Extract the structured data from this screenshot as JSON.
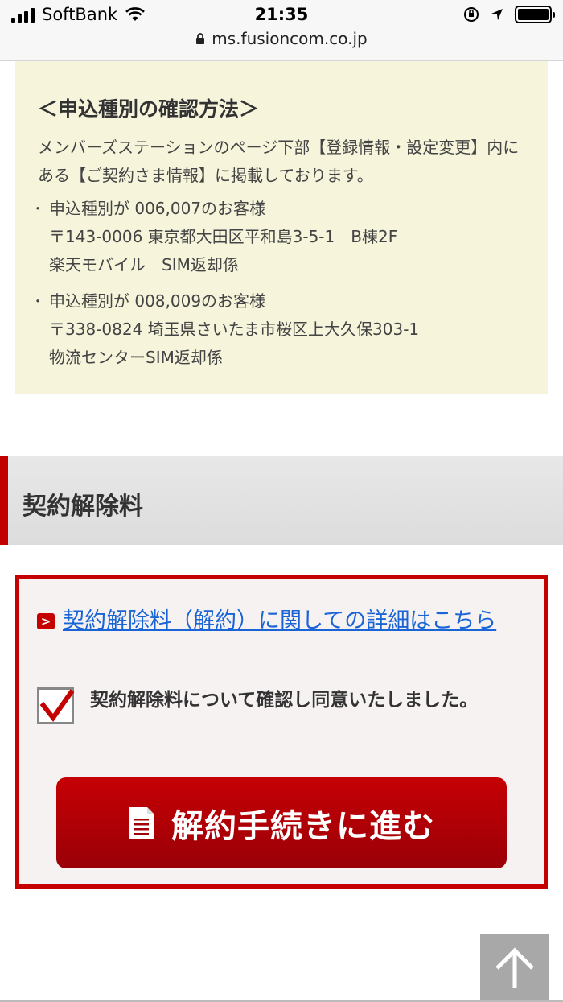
{
  "status_bar": {
    "carrier": "SoftBank",
    "time": "21:35",
    "url": "ms.fusioncom.co.jp",
    "battery_level": 1.0
  },
  "info_box": {
    "title": "＜申込種別の確認方法＞",
    "description": "メンバーズステーションのページ下部【登録情報・設定変更】内にある【ご契約さま情報】に掲載しております。",
    "items": [
      {
        "line1": "申込種別が 006,007のお客様",
        "line2": "〒143-0006 東京都大田区平和島3-5-1　B棟2F",
        "line3": "楽天モバイル　SIM返却係"
      },
      {
        "line1": "申込種別が 008,009のお客様",
        "line2": "〒338-0824 埼玉県さいたま市桜区上大久保303-1",
        "line3": "物流センターSIM返却係"
      }
    ]
  },
  "section": {
    "title": "契約解除料"
  },
  "cancel_box": {
    "link_text": "契約解除料（解約）に関しての詳細はこちら",
    "agreement_text": "契約解除料について確認し同意いたしました。",
    "agreement_checked": true,
    "proceed_label": "解約手続きに進む"
  },
  "colors": {
    "accent_red": "#c40000",
    "info_bg": "#f6f5dc",
    "link_blue": "#1a64d6"
  }
}
